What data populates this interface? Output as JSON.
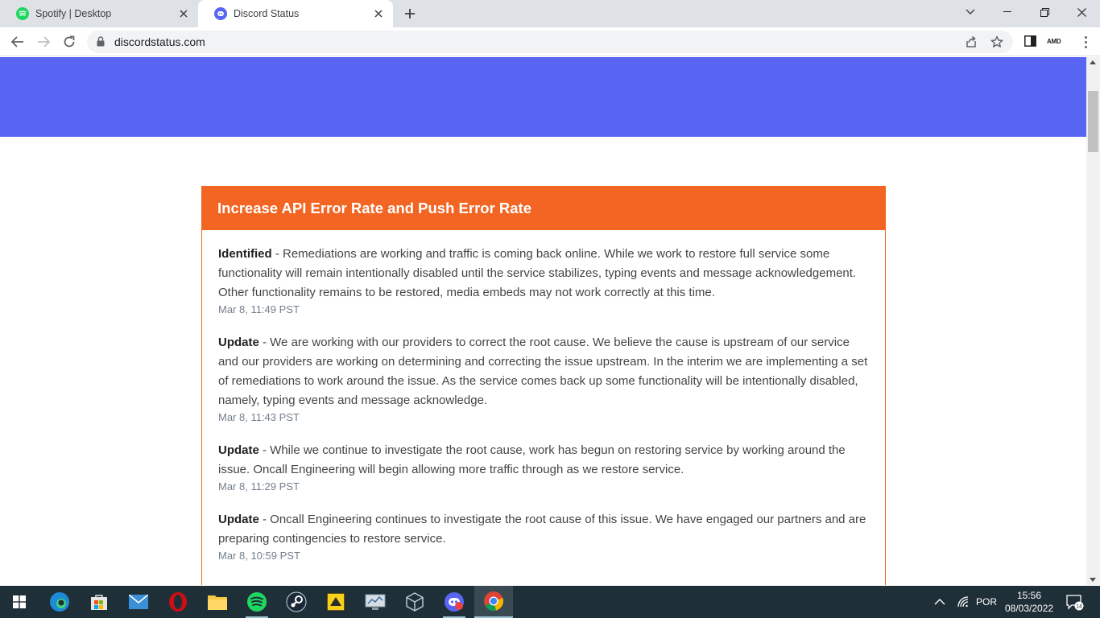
{
  "browser": {
    "tabs": [
      {
        "title": "Spotify | Desktop",
        "active": false
      },
      {
        "title": "Discord Status",
        "active": true
      }
    ],
    "url": "discordstatus.com",
    "extension_label": "AMD"
  },
  "page": {
    "incident": {
      "title": "Increase API Error Rate and Push Error Rate",
      "updates": [
        {
          "status": "Identified",
          "text": " - Remediations are working and traffic is coming back online. While we work to restore full service some functionality will remain intentionally disabled until the service stabilizes, typing events and message acknowledgement. Other functionality remains to be restored, media embeds may not work correctly at this time.",
          "time": "Mar 8, 11:49 PST"
        },
        {
          "status": "Update",
          "text": " - We are working with our providers to correct the root cause. We believe the cause is upstream of our service and our providers are working on determining and correcting the issue upstream. In the interim we are implementing a set of remediations to work around the issue. As the service comes back up some functionality will be intentionally disabled, namely, typing events and message acknowledge.",
          "time": "Mar 8, 11:43 PST"
        },
        {
          "status": "Update",
          "text": " - While we continue to investigate the root cause, work has begun on restoring service by working around the issue. Oncall Engineering will begin allowing more traffic through as we restore service.",
          "time": "Mar 8, 11:29 PST"
        },
        {
          "status": "Update",
          "text": " - Oncall Engineering continues to investigate the root cause of this issue. We have engaged our partners and are preparing contingencies to restore service.",
          "time": "Mar 8, 10:59 PST"
        }
      ]
    }
  },
  "taskbar": {
    "apps": [
      "start-icon",
      "edge-icon",
      "store-icon",
      "mail-icon",
      "opera-icon",
      "file-explorer-icon",
      "spotify-icon",
      "steam-icon",
      "app-icon",
      "monitor-icon",
      "virtualbox-icon",
      "discord-icon",
      "chrome-icon"
    ],
    "language": "POR",
    "time": "15:56",
    "date": "08/03/2022",
    "notifications": "14"
  },
  "colors": {
    "hero": "#5865f2",
    "incident_accent": "#f26522",
    "taskbar": "#1f2f38"
  }
}
